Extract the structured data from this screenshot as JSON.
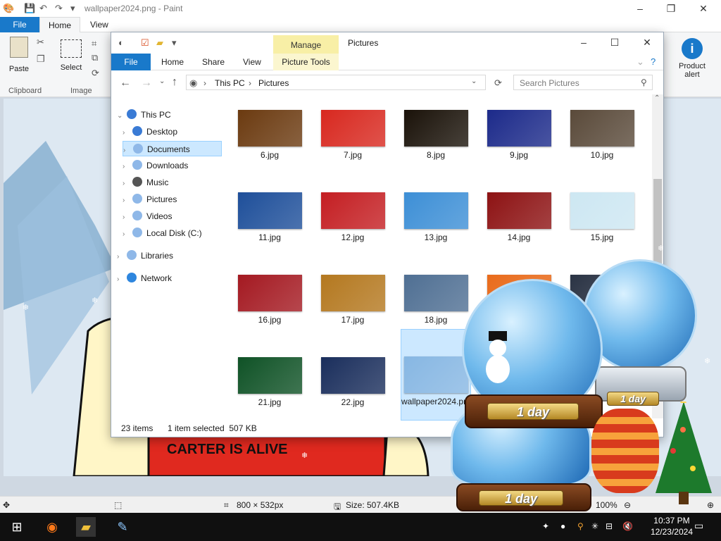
{
  "paint": {
    "title": "wallpaper2024.png - Paint",
    "tabs": {
      "file": "File",
      "home": "Home",
      "view": "View"
    },
    "ribbon": {
      "paste": "Paste",
      "clipboard": "Clipboard",
      "select": "Select",
      "image": "Image",
      "product_alert": "Product alert"
    },
    "status": {
      "dimensions": "800 × 532px",
      "size": "Size: 507.4KB",
      "zoom": "100%"
    },
    "canvas_text": "CARTER IS ALIVE"
  },
  "explorer": {
    "manage": "Manage",
    "title": "Pictures",
    "tabs": {
      "file": "File",
      "home": "Home",
      "share": "Share",
      "view": "View",
      "picture_tools": "Picture Tools"
    },
    "address": {
      "root": "This PC",
      "current": "Pictures"
    },
    "search_placeholder": "Search Pictures",
    "nav": [
      {
        "label": "This PC",
        "icon": "pc-icon"
      },
      {
        "label": "Desktop",
        "icon": "desktop-icon"
      },
      {
        "label": "Documents",
        "icon": "documents-icon"
      },
      {
        "label": "Downloads",
        "icon": "downloads-icon"
      },
      {
        "label": "Music",
        "icon": "music-icon"
      },
      {
        "label": "Pictures",
        "icon": "pictures-icon"
      },
      {
        "label": "Videos",
        "icon": "videos-icon"
      },
      {
        "label": "Local Disk (C:)",
        "icon": "disk-icon"
      },
      {
        "label": "Libraries",
        "icon": "libraries-icon"
      },
      {
        "label": "Network",
        "icon": "network-icon"
      }
    ],
    "files": [
      {
        "name": "6.jpg",
        "color": "#6b3a10"
      },
      {
        "name": "7.jpg",
        "color": "#d8281f"
      },
      {
        "name": "8.jpg",
        "color": "#1a1209"
      },
      {
        "name": "9.jpg",
        "color": "#1c2a8a"
      },
      {
        "name": "10.jpg",
        "color": "#5a4a3a"
      },
      {
        "name": "11.jpg",
        "color": "#1e4f9a"
      },
      {
        "name": "12.jpg",
        "color": "#c41e22"
      },
      {
        "name": "13.jpg",
        "color": "#3d8fd6"
      },
      {
        "name": "14.jpg",
        "color": "#8d1213"
      },
      {
        "name": "15.jpg",
        "color": "#cde7f2"
      },
      {
        "name": "16.jpg",
        "color": "#a41921"
      },
      {
        "name": "17.jpg",
        "color": "#b4781f"
      },
      {
        "name": "18.jpg",
        "color": "#4f6f93"
      },
      {
        "name": "",
        "color": "#e96b1b"
      },
      {
        "name": "",
        "color": "#2a3344"
      },
      {
        "name": "21.jpg",
        "color": "#0f5226"
      },
      {
        "name": "22.jpg",
        "color": "#1a2e5c"
      },
      {
        "name": "wallpaper2024.png",
        "color": "#87b7e3"
      }
    ],
    "status": {
      "count": "23 items",
      "selected": "1 item selected  507 KB"
    }
  },
  "globes": {
    "plaque_text": "1 day"
  },
  "taskbar": {
    "time": "10:37 PM",
    "date": "12/23/2024"
  }
}
